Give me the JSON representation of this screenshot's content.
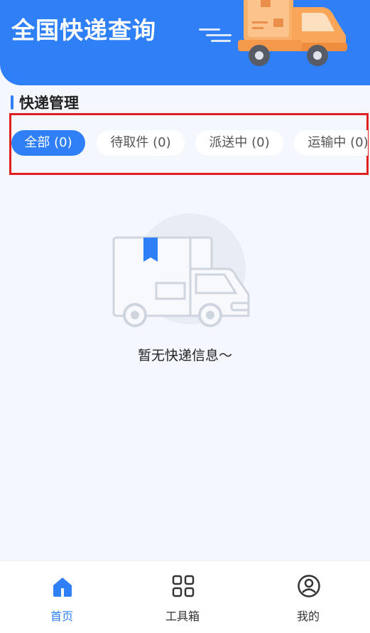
{
  "header": {
    "title": "全国快递查询"
  },
  "section": {
    "title": "快递管理"
  },
  "tabs": [
    {
      "label": "全部 (0)",
      "active": true
    },
    {
      "label": "待取件 (0)",
      "active": false
    },
    {
      "label": "派送中 (0)",
      "active": false
    },
    {
      "label": "运输中 (0)",
      "active": false
    }
  ],
  "empty_state": {
    "text": "暂无快递信息～"
  },
  "bottom_nav": [
    {
      "label": "首页",
      "icon": "home-icon",
      "active": true
    },
    {
      "label": "工具箱",
      "icon": "grid-icon",
      "active": false
    },
    {
      "label": "我的",
      "icon": "user-icon",
      "active": false
    }
  ],
  "colors": {
    "primary": "#2f80f6",
    "highlight": "#e02020"
  }
}
